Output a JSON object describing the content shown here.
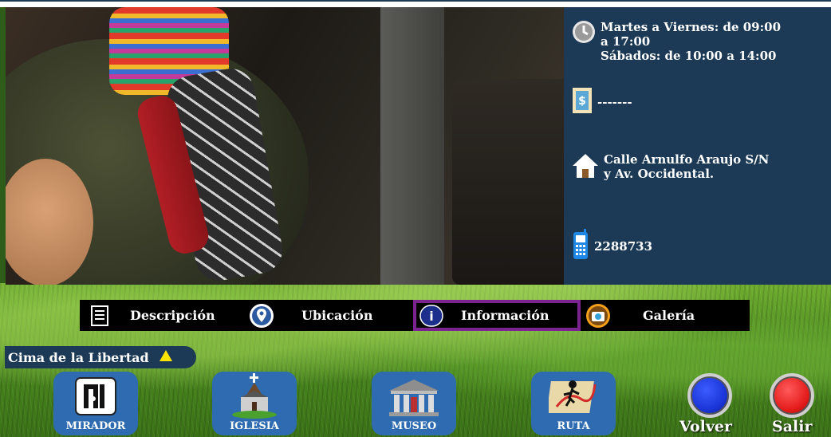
{
  "info": {
    "hours": [
      "Martes a Viernes: de  09:00",
      "a 17:00",
      "Sábados: de 10:00 a 14:00"
    ],
    "price": "-------",
    "address": [
      "Calle Arnulfo Araujo S/N",
      "y Av. Occidental."
    ],
    "phone": "2288733",
    "icons": [
      "clock-icon",
      "money-icon",
      "house-icon",
      "phone-icon"
    ]
  },
  "tabs": [
    {
      "label": "Descripción",
      "icon": "document-icon"
    },
    {
      "label": "Ubicación",
      "icon": "map-pin-icon"
    },
    {
      "label": "Información",
      "icon": "info-icon",
      "active": true
    },
    {
      "label": "Galería",
      "icon": "camera-icon"
    }
  ],
  "place_title": "Cima de la Libertad",
  "nav": [
    {
      "label": "MIRADOR",
      "icon": "viewpoint-icon"
    },
    {
      "label": "IGLESIA",
      "icon": "church-icon"
    },
    {
      "label": "MUSEO",
      "icon": "museum-icon"
    },
    {
      "label": "RUTA",
      "icon": "route-icon"
    }
  ],
  "actions": {
    "back": "Volver",
    "exit": "Salir"
  },
  "colors": {
    "panel": "#1c3a55",
    "active_tab": "#7b2391",
    "nav_button": "#2e6bb0",
    "back": "#1a34d6",
    "exit": "#e41b1b"
  }
}
